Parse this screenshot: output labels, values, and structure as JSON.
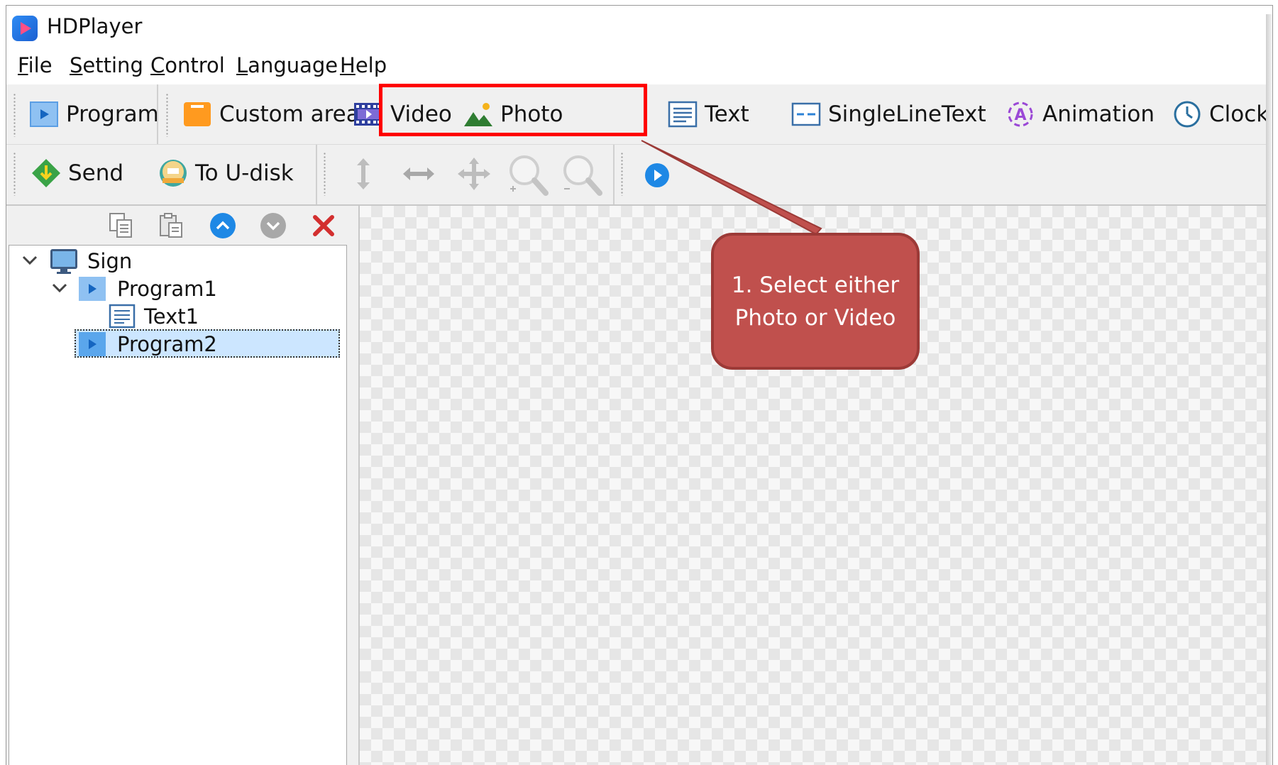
{
  "app": {
    "title": "HDPlayer"
  },
  "menu": [
    {
      "label": "File"
    },
    {
      "label": "Setting"
    },
    {
      "label": "Control"
    },
    {
      "label": "Language"
    },
    {
      "label": "Help"
    }
  ],
  "toolbar_primary": [
    {
      "label": "Program",
      "icon": "program-icon"
    },
    {
      "label": "Custom area",
      "icon": "custom-area-icon"
    },
    {
      "label": "Video",
      "icon": "video-icon"
    },
    {
      "label": "Photo",
      "icon": "photo-icon"
    },
    {
      "label": "Text",
      "icon": "text-icon"
    },
    {
      "label": "SingleLineText",
      "icon": "single-line-text-icon"
    },
    {
      "label": "Animation",
      "icon": "animation-icon"
    },
    {
      "label": "Clock",
      "icon": "clock-icon"
    }
  ],
  "toolbar_secondary": [
    {
      "label": "Send",
      "icon": "send-icon"
    },
    {
      "label": "To U-disk",
      "icon": "u-disk-icon"
    }
  ],
  "toolbar_tools": [
    "resize-vertical-icon",
    "resize-horizontal-icon",
    "move-icon",
    "zoom-in-icon",
    "zoom-out-icon",
    "play-icon"
  ],
  "tree_toolbar": [
    "copy-icon",
    "paste-icon",
    "move-up-icon",
    "move-down-icon",
    "delete-icon"
  ],
  "tree": {
    "root": {
      "label": "Sign"
    },
    "items": [
      {
        "label": "Program1"
      },
      {
        "label": "Text1"
      },
      {
        "label": "Program2",
        "selected": true
      }
    ]
  },
  "annotation": {
    "line1": "1. Select either",
    "line2": "Photo or Video",
    "color": "#c0504d",
    "highlight_color": "#ff0000"
  }
}
